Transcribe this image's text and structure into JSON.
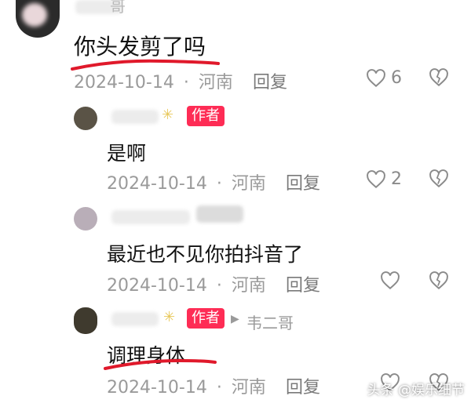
{
  "comments": [
    {
      "name": "哥",
      "content": "你头发剪了吗",
      "date": "2024-10-14",
      "location": "河南",
      "reply_label": "回复",
      "likes": "6"
    },
    {
      "badge": "作者",
      "content": "是啊",
      "date": "2024-10-14",
      "location": "河南",
      "reply_label": "回复",
      "likes": "2"
    },
    {
      "content": "最近也不见你拍抖音了",
      "date": "2024-10-14",
      "location": "河南",
      "reply_label": "回复"
    },
    {
      "badge": "作者",
      "reply_to": "韦二哥",
      "content": "调理身体",
      "date": "2024-10-14",
      "location": "河南",
      "reply_label": "回复"
    }
  ],
  "separator": "·",
  "watermark": "头条 @娱乐细节",
  "colors": {
    "badge": "#fe2c55",
    "underline": "#e0192b",
    "meta": "#9a9a9a"
  },
  "icons": [
    "heart-icon",
    "broken-heart-icon",
    "play-arrow-icon",
    "sparkle-icon"
  ]
}
